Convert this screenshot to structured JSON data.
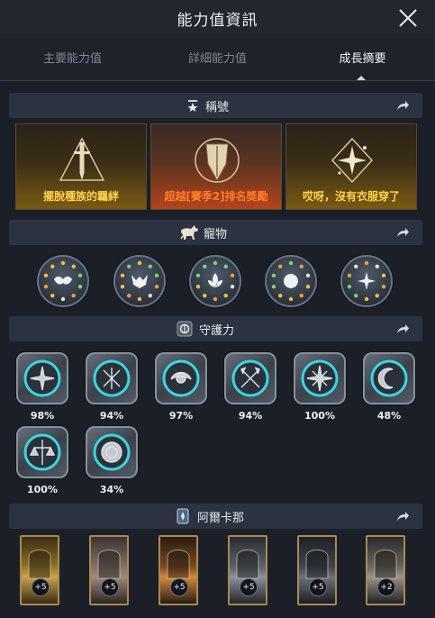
{
  "header": {
    "title": "能力值資訊"
  },
  "tabs": [
    {
      "label": "主要能力值"
    },
    {
      "label": "詳細能力值"
    },
    {
      "label": "成長摘要"
    }
  ],
  "sections": {
    "titles": {
      "label": "稱號"
    },
    "pets": {
      "label": "寵物"
    },
    "guardian": {
      "label": "守護力"
    },
    "arcana": {
      "label": "阿爾卡那"
    }
  },
  "title_cards": [
    {
      "label": "擺脫種族的羈絆",
      "color": "#ffd34a"
    },
    {
      "label": "超越[賽季2]排名獎勵",
      "color": "#ff7a2a"
    },
    {
      "label": "哎呀，沒有衣服穿了",
      "color": "#ffd34a"
    }
  ],
  "pets": [
    {
      "icon": "mask-emblem-icon"
    },
    {
      "icon": "demon-mask-emblem-icon"
    },
    {
      "icon": "lotus-emblem-icon"
    },
    {
      "icon": "orb-emblem-icon"
    },
    {
      "icon": "star-emblem-icon"
    }
  ],
  "guardian_items": [
    {
      "icon": "spiked-shield-icon",
      "value": "98%"
    },
    {
      "icon": "crossed-blades-icon",
      "value": "94%"
    },
    {
      "icon": "winged-orb-icon",
      "value": "97%"
    },
    {
      "icon": "crossed-swords-icon",
      "value": "94%"
    },
    {
      "icon": "compass-star-icon",
      "value": "100%"
    },
    {
      "icon": "crescent-moon-icon",
      "value": "48%"
    },
    {
      "icon": "scales-sword-icon",
      "value": "100%"
    },
    {
      "icon": "ornate-ring-icon",
      "value": "34%"
    }
  ],
  "arcana_cards": [
    {
      "icon": "golden-chalice-card-icon",
      "badge": "+5"
    },
    {
      "icon": "dragon-wheel-card-icon",
      "badge": "+5"
    },
    {
      "icon": "fire-ritual-card-icon",
      "badge": "+5"
    },
    {
      "icon": "bell-tower-card-icon",
      "badge": "+5"
    },
    {
      "icon": "crowned-mirror-card-icon",
      "badge": "+5"
    },
    {
      "icon": "gothic-gate-card-icon",
      "badge": "+2"
    }
  ],
  "colors": {
    "background": "#1b1f28",
    "section_bar": "#2c3240",
    "cyan_ring": "#39d6e4",
    "gold_border": "#a88a4e",
    "title_gold": "#ffd34a",
    "title_orange": "#ff7a2a"
  }
}
